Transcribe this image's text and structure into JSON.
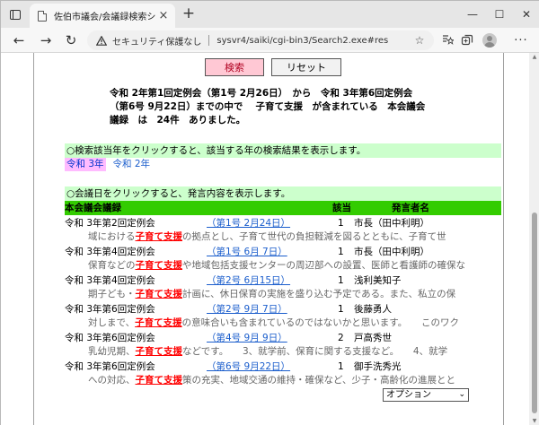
{
  "browser": {
    "tab_title": "佐伯市議会/会議録検索システム",
    "tab_close": "×",
    "new_tab": "+",
    "security_label": "セキュリティ保護なし",
    "url": "sysvr4/saiki/cgi-bin3/Search2.exe#res",
    "controls": {
      "minimize": "—",
      "maximize": "☐",
      "close": "✕"
    },
    "nav": {
      "back": "←",
      "forward": "→",
      "reload": "↻"
    }
  },
  "buttons": {
    "search": "検索",
    "reset": "リセット"
  },
  "summary": {
    "line1": "令和 2年第1回定例会（第1号 2月26日）　から　令和 3年第6回定例会",
    "line2": "（第6号 9月22日）までの中で　 子育て支援　が含まれている　本会議会",
    "line3": "議録　は　24件　ありました。"
  },
  "year_section": {
    "instruction": "○検索該当年をクリックすると、該当する年の検索結果を表示します。",
    "current_year": "令和 3年",
    "other_year": "令和 2年"
  },
  "date_section": {
    "instruction": "○会議日をクリックすると、発言内容を表示します。"
  },
  "table": {
    "header": {
      "meeting": "本会議会議録",
      "count": "該当",
      "speaker": "発言者名"
    },
    "rows": [
      {
        "meeting": "令和 3年第2回定例会",
        "date": "（第1号 2月24日）",
        "count": "1",
        "speaker": "市長（田中利明）",
        "pre": "域における",
        "hit": "子育て支援",
        "post": "の拠点とし、子育て世代の負担軽減を図るとともに、子育て世"
      },
      {
        "meeting": "令和 3年第4回定例会",
        "date": "（第1号 6月 7日）",
        "count": "1",
        "speaker": "市長（田中利明）",
        "pre": "保育などの",
        "hit": "子育て支援",
        "post": "や地域包括支援センターの周辺部への設置、医師と看護師の確保な"
      },
      {
        "meeting": "令和 3年第4回定例会",
        "date": "（第2号 6月15日）",
        "count": "1",
        "speaker": "浅利美知子",
        "pre": "期子ども・",
        "hit": "子育て支援",
        "post": "計画に、休日保育の実施を盛り込む予定である。また、私立の保"
      },
      {
        "meeting": "令和 3年第6回定例会",
        "date": "（第2号 9月 7日）",
        "count": "1",
        "speaker": "後藤勇人",
        "pre": "対しまで、",
        "hit": "子育て支援",
        "post": "の意味合いも含まれているのではないかと思います。　　このワク"
      },
      {
        "meeting": "令和 3年第6回定例会",
        "date": "（第4号 9月 9日）",
        "count": "2",
        "speaker": "戸高秀世",
        "pre": "乳幼児期、",
        "hit": "子育て支援",
        "post": "などです。　　3、就学前、保育に関する支援など。　　4、就学"
      },
      {
        "meeting": "令和 3年第6回定例会",
        "date": "（第6号 9月22日）",
        "count": "1",
        "speaker": "御手洗秀光",
        "pre": "への対応、",
        "hit": "子育て支援",
        "post": "策の充実、地域交通の維持・確保など、少子・高齢化の進展とと"
      }
    ]
  },
  "option_select": {
    "value": "オプション",
    "chevron": "⌄"
  }
}
